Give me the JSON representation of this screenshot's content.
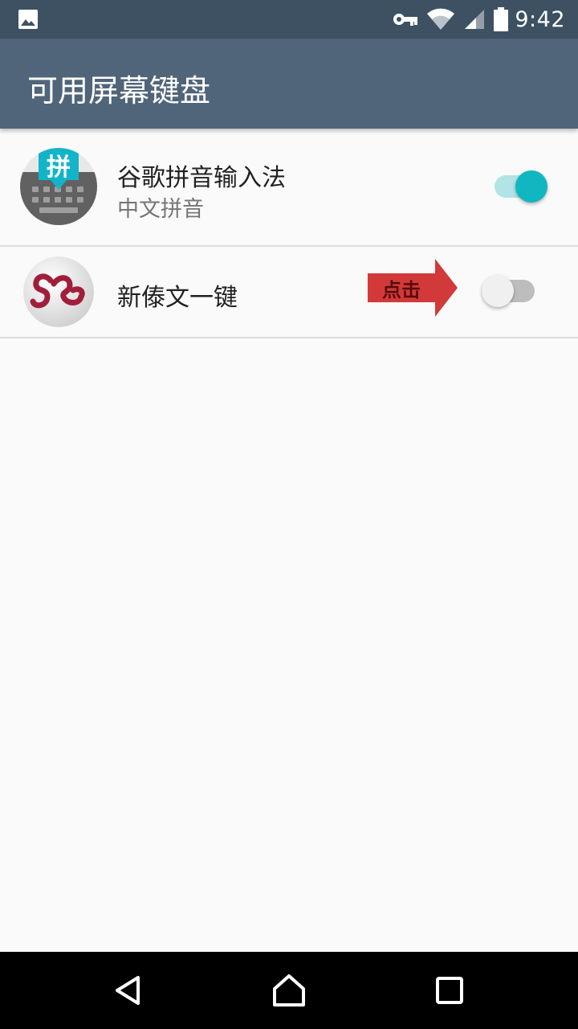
{
  "status_bar": {
    "time": "9:42",
    "icons": [
      "gallery-icon",
      "vpn-key-icon",
      "wifi-icon",
      "cell-signal-icon",
      "battery-icon"
    ]
  },
  "app_bar": {
    "title": "可用屏幕键盘"
  },
  "keyboards": [
    {
      "name": "谷歌拼音输入法",
      "subtitle": "中文拼音",
      "icon_glyph": "拼",
      "enabled": true
    },
    {
      "name": "新傣文一键",
      "enabled": false
    }
  ],
  "annotation": {
    "text": "点击"
  },
  "colors": {
    "status_bar": "#3e5163",
    "app_bar": "#506579",
    "accent": "#10b6c0",
    "arrow": "#d23a3a"
  },
  "nav_bar": {
    "icons": [
      "back-icon",
      "home-icon",
      "recents-icon"
    ]
  }
}
